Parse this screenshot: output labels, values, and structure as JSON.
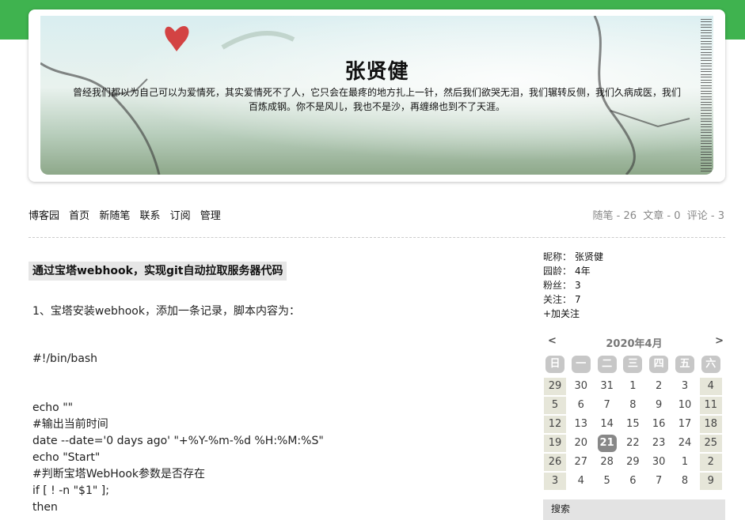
{
  "header": {
    "title": "张贤健",
    "description": "曾经我们都以为自己可以为爱情死，其实爱情死不了人，它只会在最疼的地方扎上一针，然后我们欲哭无泪，我们辗转反侧，我们久病成医，我们百炼成钢。你不是风儿，我也不是沙，再缠绵也到不了天涯。"
  },
  "nav": {
    "items": [
      "博客园",
      "首页",
      "新随笔",
      "联系",
      "订阅",
      "管理"
    ]
  },
  "stats": {
    "text": "随笔 - 26  文章 - 0  评论 - 3"
  },
  "post": {
    "title": "通过宝塔webhook，实现git自动拉取服务器代码",
    "lines": [
      "1、宝塔安装webhook，添加一条记录，脚本内容为：",
      "#!/bin/bash",
      "echo \"\"",
      "#输出当前时间",
      "date --date='0 days ago' \"+%Y-%m-%d %H:%M:%S\"",
      "echo \"Start\"",
      "#判断宝塔WebHook参数是否存在",
      "if [ ! -n \"$1\" ];",
      "then"
    ]
  },
  "profile": {
    "rows": [
      {
        "k": "昵称：",
        "v": "张贤健"
      },
      {
        "k": "园龄：",
        "v": "4年"
      },
      {
        "k": "粉丝：",
        "v": "3"
      },
      {
        "k": "关注：",
        "v": "7"
      }
    ],
    "follow_label": "+加关注"
  },
  "calendar": {
    "prev": "<",
    "next": ">",
    "month": "2020年4月",
    "weekdays": [
      "日",
      "一",
      "二",
      "三",
      "四",
      "五",
      "六"
    ],
    "weeks": [
      [
        "29",
        "30",
        "31",
        "1",
        "2",
        "3",
        "4"
      ],
      [
        "5",
        "6",
        "7",
        "8",
        "9",
        "10",
        "11"
      ],
      [
        "12",
        "13",
        "14",
        "15",
        "16",
        "17",
        "18"
      ],
      [
        "19",
        "20",
        "21",
        "22",
        "23",
        "24",
        "25"
      ],
      [
        "26",
        "27",
        "28",
        "29",
        "30",
        "1",
        "2"
      ],
      [
        "3",
        "4",
        "5",
        "6",
        "7",
        "8",
        "9"
      ]
    ],
    "today": "21"
  },
  "sidebar": {
    "search_label": "搜索"
  }
}
